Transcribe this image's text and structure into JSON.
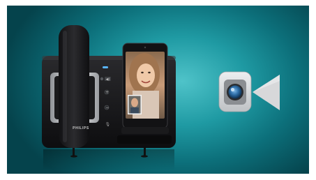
{
  "scene": {
    "background_colors": [
      "#4fc3c9",
      "#1f9aa3",
      "#0c6f7a",
      "#05434c"
    ],
    "device": {
      "brand": "PHILIPS",
      "body_color": "#1c1c1e",
      "accent_color": "#e8e8e8",
      "led_color": "#5ab6ff"
    },
    "video_call_app_icon": {
      "icon_name": "video-camera-app-icon",
      "tile_color": "#d7d8da",
      "camera_color": "#8b8e92",
      "lens_color": "#2f6ea8"
    }
  }
}
